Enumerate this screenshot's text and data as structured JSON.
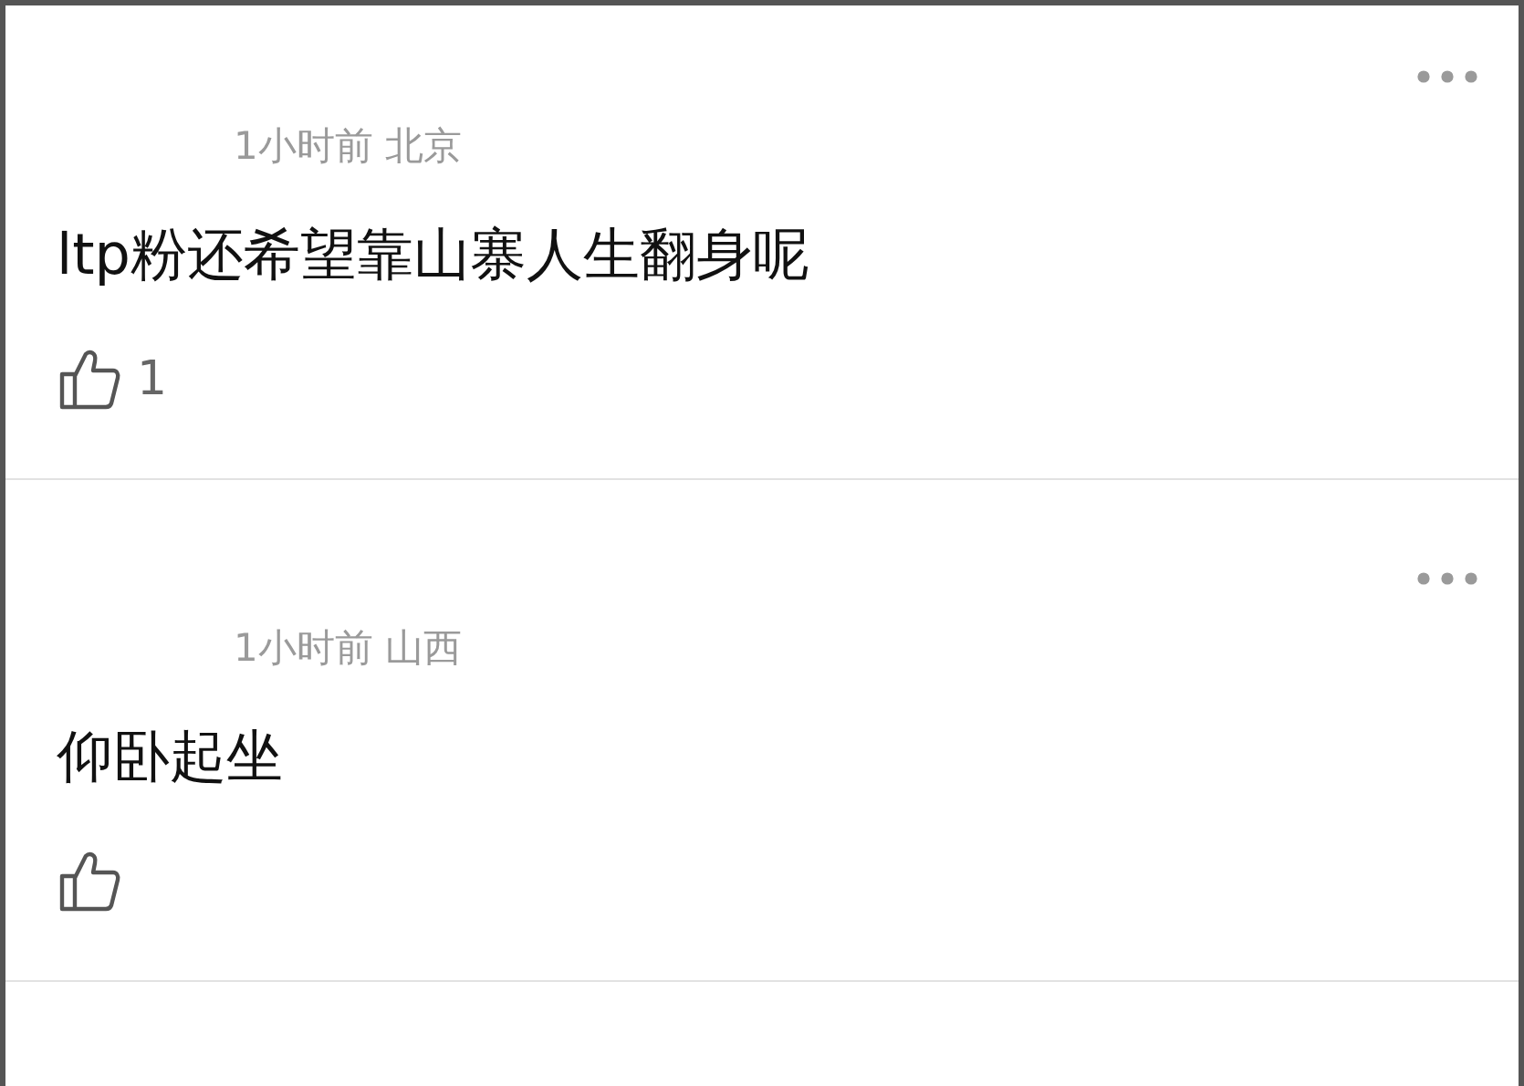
{
  "comments": [
    {
      "time": "1小时前",
      "location": "北京",
      "text": "ltp粉还希望靠山寨人生翻身呢",
      "likes": "1"
    },
    {
      "time": "1小时前",
      "location": "山西",
      "text": "仰卧起坐"
    }
  ]
}
